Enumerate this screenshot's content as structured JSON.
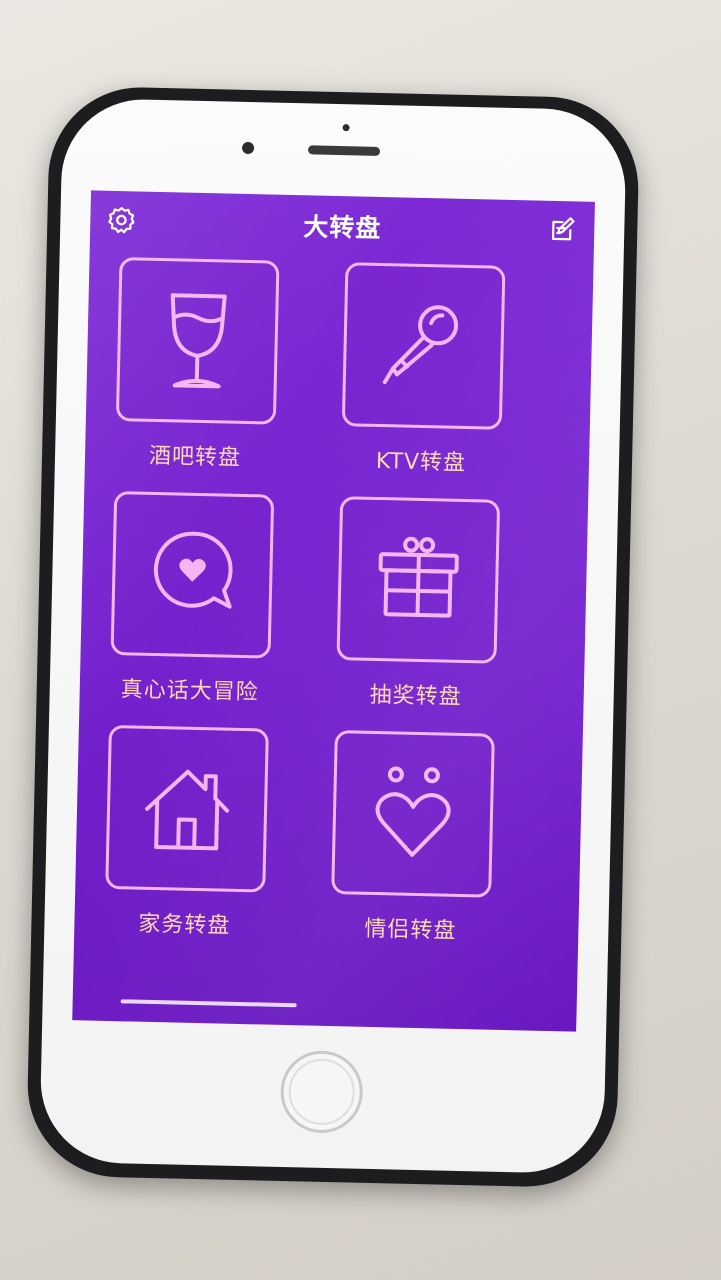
{
  "app": {
    "title": "大转盘"
  },
  "toolbar": {
    "settings_icon": "gear-icon",
    "edit_icon": "edit-icon"
  },
  "tiles": [
    {
      "label": "酒吧转盘",
      "icon": "wine-glass-icon"
    },
    {
      "label": "KTV转盘",
      "icon": "microphone-icon"
    },
    {
      "label": "真心话大冒险",
      "icon": "heart-chat-bubble-icon"
    },
    {
      "label": "抽奖转盘",
      "icon": "gift-icon"
    },
    {
      "label": "家务转盘",
      "icon": "house-icon"
    },
    {
      "label": "情侣转盘",
      "icon": "couple-heart-icon"
    }
  ],
  "colors": {
    "screen_background": "#7522cf",
    "tile_border": "#f4b5f2",
    "tile_label": "#ffd7b6",
    "title": "#ffffff"
  }
}
